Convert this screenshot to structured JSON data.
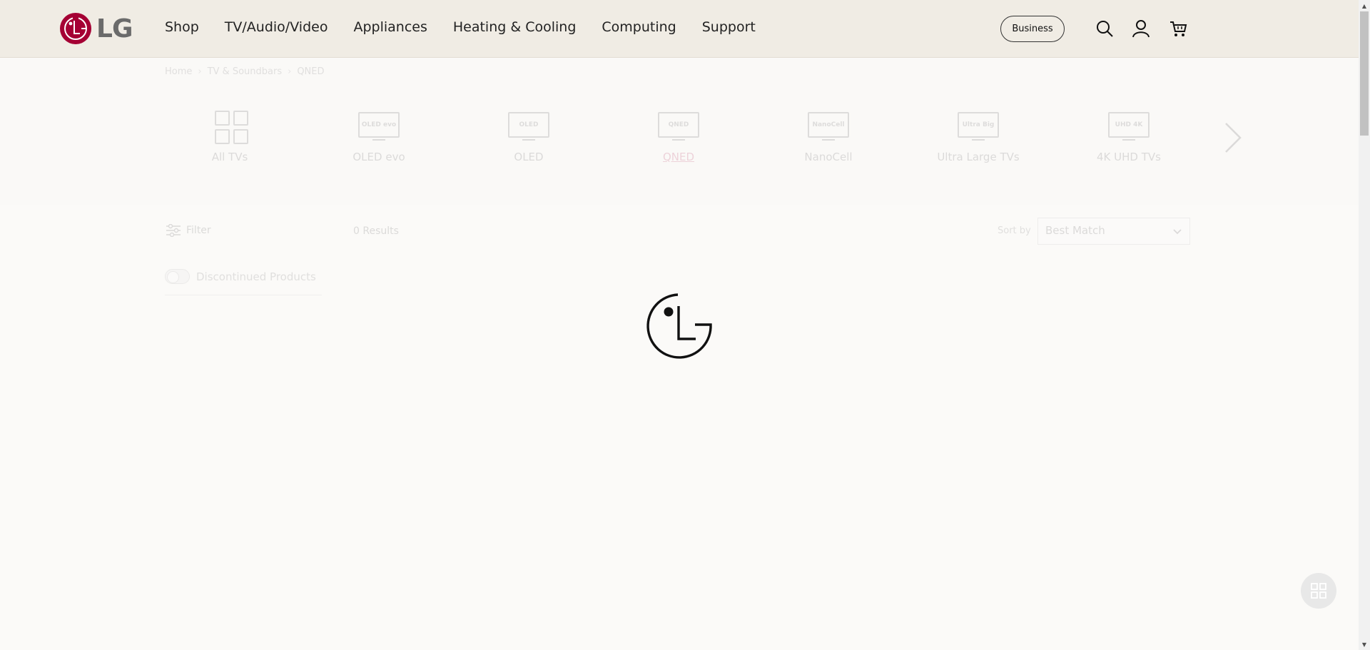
{
  "header": {
    "logo_text": "LG",
    "brand_color": "#a50034",
    "nav": [
      "Shop",
      "TV/Audio/Video",
      "Appliances",
      "Heating & Cooling",
      "Computing",
      "Support"
    ],
    "business_label": "Business",
    "icons": [
      "search-icon",
      "account-icon",
      "cart-icon"
    ]
  },
  "breadcrumb": [
    "Home",
    "TV & Soundbars",
    "QNED"
  ],
  "categories": [
    {
      "label": "All TVs",
      "icon": "grid-icon"
    },
    {
      "label": "OLED evo",
      "icon_text": "OLED evo"
    },
    {
      "label": "OLED",
      "icon_text": "OLED"
    },
    {
      "label": "QNED",
      "icon_text": "QNED",
      "active": true
    },
    {
      "label": "NanoCell",
      "icon_text": "NanoCell"
    },
    {
      "label": "Ultra Large TVs",
      "icon_text": "Ultra Big"
    },
    {
      "label": "4K UHD TVs",
      "icon_text": "UHD 4K"
    }
  ],
  "toolbar": {
    "filter_label": "Filter",
    "results_label": "0 Results",
    "sort_label": "Sort by",
    "sort_value": "Best Match"
  },
  "discontinued_label": "Discontinued Products"
}
